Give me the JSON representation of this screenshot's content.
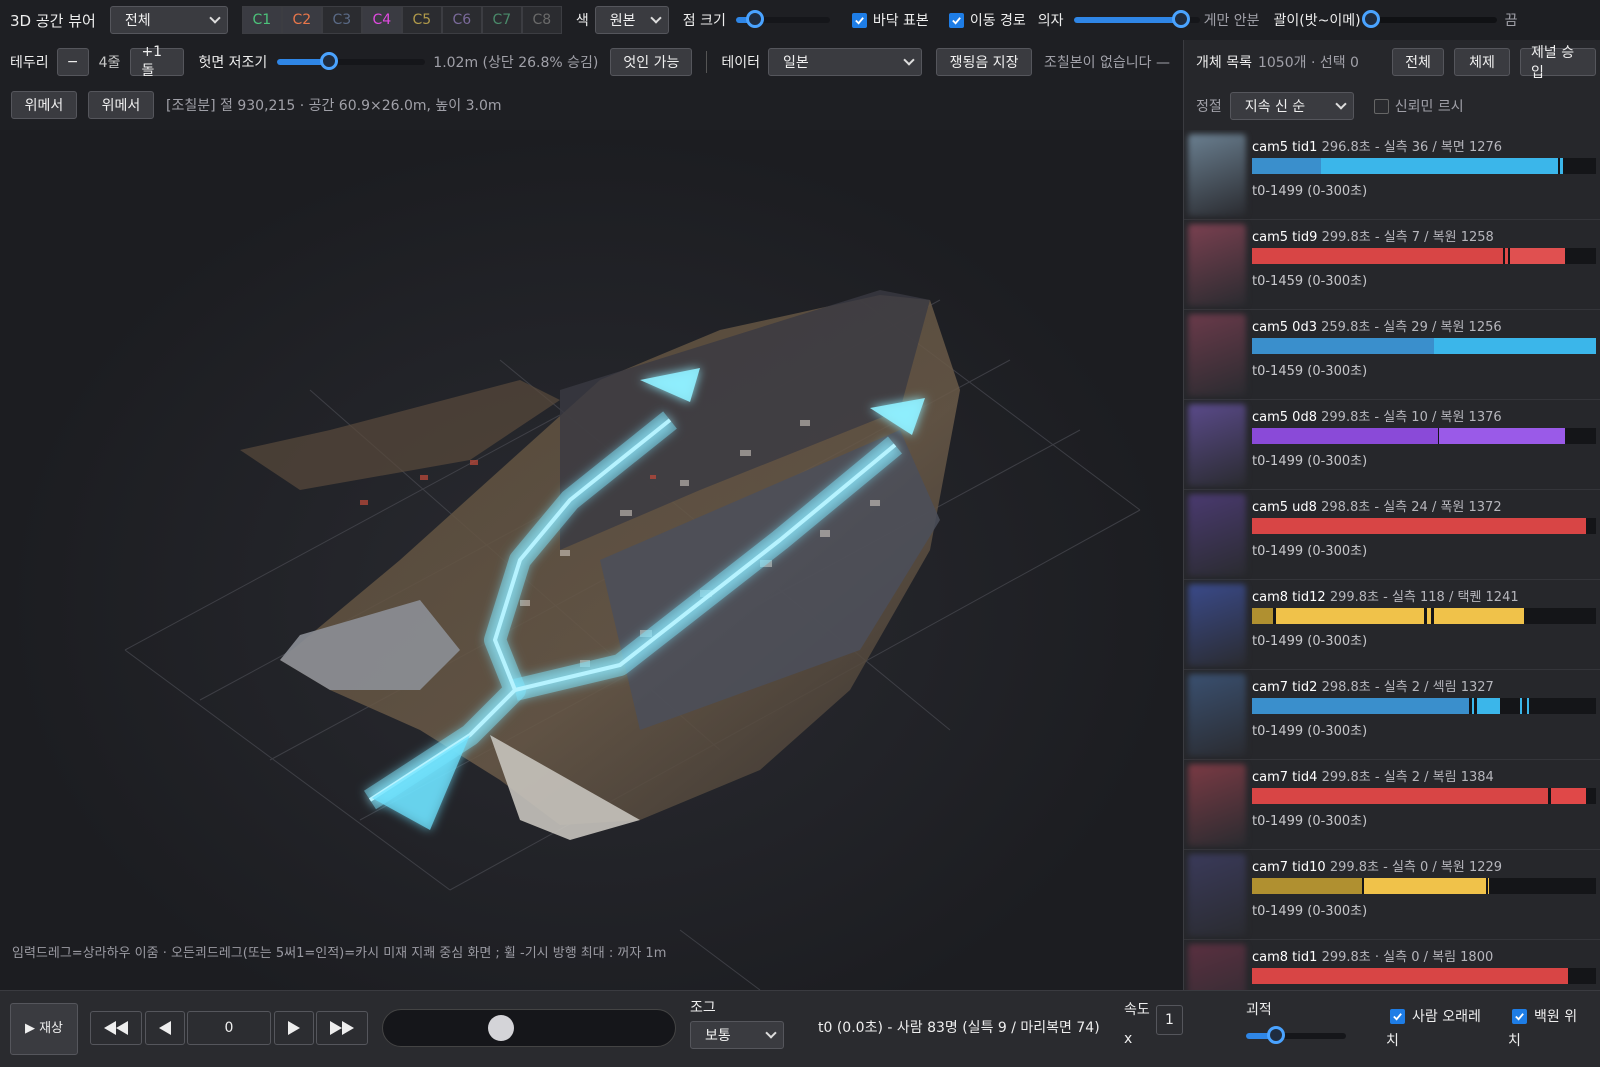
{
  "toolbar1": {
    "app_title": "3D 공간 뷰어",
    "scope_select": "전체",
    "cameras": [
      {
        "label": "C1",
        "color": "#4cc27a"
      },
      {
        "label": "C2",
        "color": "#e8764a"
      },
      {
        "label": "C3",
        "color": "#5a6a86"
      },
      {
        "label": "C4",
        "color": "#e04ae0"
      },
      {
        "label": "C5",
        "color": "#b09a4a"
      },
      {
        "label": "C6",
        "color": "#7a6a9a"
      },
      {
        "label": "C7",
        "color": "#4a8a6a"
      },
      {
        "label": "C8",
        "color": "#6a6a6a"
      }
    ],
    "color_label": "색",
    "color_select": "원본",
    "point_size_label": "점 크기",
    "point_size_value": 0.2,
    "floor_label": "바닥 표본",
    "floor_checked": true,
    "path_label": "이동 경로",
    "path_checked": true,
    "chair_label": "의자",
    "chair_value": 0.85,
    "chair_right_label": "게만 안분",
    "height_label": "괄이(밧~이메)",
    "height_value": 0.0,
    "end_label": "끔"
  },
  "toolbar2": {
    "border_label": "테두리",
    "minus": "−",
    "border_value": "4줄",
    "plus": "+1돌",
    "slice_label": "헛면 저조기",
    "slice_value": 0.35,
    "slice_readout": "1.02m (상단 26.8% 승김)",
    "ignore_button": "엇인 가능",
    "data_label": "테이터",
    "data_select": "일본",
    "save_button": "쟁됭음 지장",
    "notice": "조칠본이 없습니다 —"
  },
  "toolbar3": {
    "btn_a": "위메서",
    "btn_b": "위메서",
    "info": "[조칠분] 절 930,215 · 공간 60.9×26.0m, 높이 3.0m"
  },
  "sidebar": {
    "header": "개체 목록",
    "count": "1050개 · 선택 0",
    "btn_all": "전체",
    "btn_clear": "체제",
    "btn_apply": "제널 승입",
    "sort_label": "정절",
    "sort_select": "지속 신 순",
    "confidence_label": "신뢰민 르시",
    "items": [
      {
        "cam": "cam5 tid1",
        "meta": "296.8초 - 실측 36 / 복면 1276",
        "range": "t0-1499 (0-300초)",
        "color": "#3bb6ea",
        "thumb": "#6a7f90",
        "segs": [
          {
            "s": 0.0,
            "e": 0.2,
            "c": "#3a8fcc"
          },
          {
            "s": 0.2,
            "e": 0.89,
            "c": "#3bb6ea"
          },
          {
            "s": 0.895,
            "e": 0.905,
            "c": "#3bb6ea"
          }
        ]
      },
      {
        "cam": "cam5 tid9",
        "meta": "299.8초 - 실측 7 / 복원 1258",
        "range": "t0-1459 (0-300초)",
        "color": "#e04848",
        "thumb": "#7a4050",
        "segs": [
          {
            "s": 0.0,
            "e": 0.73,
            "c": "#d84545"
          },
          {
            "s": 0.735,
            "e": 0.745,
            "c": "#e04848"
          },
          {
            "s": 0.75,
            "e": 0.91,
            "c": "#e05050"
          }
        ]
      },
      {
        "cam": "cam5 0d3",
        "meta": "259.8초 - 실측 29 / 복원 1256",
        "range": "t0-1459 (0-300초)",
        "color": "#3bb6ea",
        "thumb": "#6a3a4a",
        "segs": [
          {
            "s": 0.0,
            "e": 0.53,
            "c": "#3a8fcc"
          },
          {
            "s": 0.53,
            "e": 1.0,
            "c": "#3bb6ea"
          }
        ]
      },
      {
        "cam": "cam5 0d8",
        "meta": "299.8초 - 실측 10 / 복원 1376",
        "range": "t0-1499 (0-300초)",
        "color": "#9a5ae8",
        "thumb": "#5a4a8a",
        "segs": [
          {
            "s": 0.0,
            "e": 0.54,
            "c": "#8a4ad8"
          },
          {
            "s": 0.545,
            "e": 0.91,
            "c": "#9a5ae8"
          }
        ]
      },
      {
        "cam": "cam5 ud8",
        "meta": "298.8초 - 실측 24 / 폭원 1372",
        "range": "t0-1499 (0-300초)",
        "color": "#e04848",
        "thumb": "#4a3a70",
        "segs": [
          {
            "s": 0.0,
            "e": 0.97,
            "c": "#d84545"
          }
        ]
      },
      {
        "cam": "cam8 tid12",
        "meta": "299.8초 - 실측 118 / 택퀜 1241",
        "range": "t0-1499 (0-300초)",
        "color": "#f0c24a",
        "thumb": "#3a4a8a",
        "segs": [
          {
            "s": 0.0,
            "e": 0.06,
            "c": "#b09030"
          },
          {
            "s": 0.07,
            "e": 0.5,
            "c": "#f0c24a"
          },
          {
            "s": 0.51,
            "e": 0.52,
            "c": "#f0c24a"
          },
          {
            "s": 0.53,
            "e": 0.79,
            "c": "#f0c24a"
          }
        ]
      },
      {
        "cam": "cam7 tid2",
        "meta": "298.8초 - 실측 2 / 섹림 1327",
        "range": "t0-1499 (0-300초)",
        "color": "#3bb6ea",
        "thumb": "#3a5070",
        "segs": [
          {
            "s": 0.0,
            "e": 0.63,
            "c": "#3a8fcc"
          },
          {
            "s": 0.64,
            "e": 0.645,
            "c": "#3bb6ea"
          },
          {
            "s": 0.655,
            "e": 0.72,
            "c": "#3bb6ea"
          },
          {
            "s": 0.78,
            "e": 0.785,
            "c": "#3bb6ea"
          },
          {
            "s": 0.8,
            "e": 0.805,
            "c": "#3bb6ea"
          }
        ]
      },
      {
        "cam": "cam7 tid4",
        "meta": "299.8초 - 실측 2 / 복림 1384",
        "range": "t0-1499 (0-300초)",
        "color": "#e04848",
        "thumb": "#7a3a44",
        "segs": [
          {
            "s": 0.0,
            "e": 0.86,
            "c": "#d84545"
          },
          {
            "s": 0.87,
            "e": 0.97,
            "c": "#e04848"
          }
        ]
      },
      {
        "cam": "cam7 tid10",
        "meta": "299.8초 - 실측 0 / 복원 1229",
        "range": "t0-1499 (0-300초)",
        "color": "#f0c24a",
        "thumb": "#3a3a5a",
        "segs": [
          {
            "s": 0.0,
            "e": 0.32,
            "c": "#b09030"
          },
          {
            "s": 0.325,
            "e": 0.68,
            "c": "#f0c24a"
          },
          {
            "s": 0.685,
            "e": 0.69,
            "c": "#f0c24a"
          }
        ]
      },
      {
        "cam": "cam8 tid1",
        "meta": "299.8초 · 실측 0 / 복림 1800",
        "range": "",
        "color": "#e04848",
        "thumb": "#5a3040",
        "segs": [
          {
            "s": 0.0,
            "e": 0.92,
            "c": "#d84545"
          }
        ]
      }
    ]
  },
  "viewport": {
    "hint": "임력드레그=상라하우 이줌 · 오든쾨드레그(또는 5써1=인적)=카시 미재 지쾌 중심 화면 ; 휠 -기시 방행 최대 : 꺼자 1m"
  },
  "bottom": {
    "play_label": "▶ 재상",
    "frame_value": "0",
    "timeline_value": 0.4,
    "speed_group_label": "조그",
    "speed_select": "보통",
    "status": "t0 (0.0초) - 사람 83명 (실특 9 / 마리복면 74)",
    "speed_label": "속도",
    "speed_x": "x",
    "speed_value": "1",
    "trail_label": "괴적",
    "trail_value": 0.3,
    "person_pos_label": "사람 오래레 치",
    "person_pos_checked": true,
    "track_pos_label": "백원 위 치",
    "track_pos_checked": true
  }
}
